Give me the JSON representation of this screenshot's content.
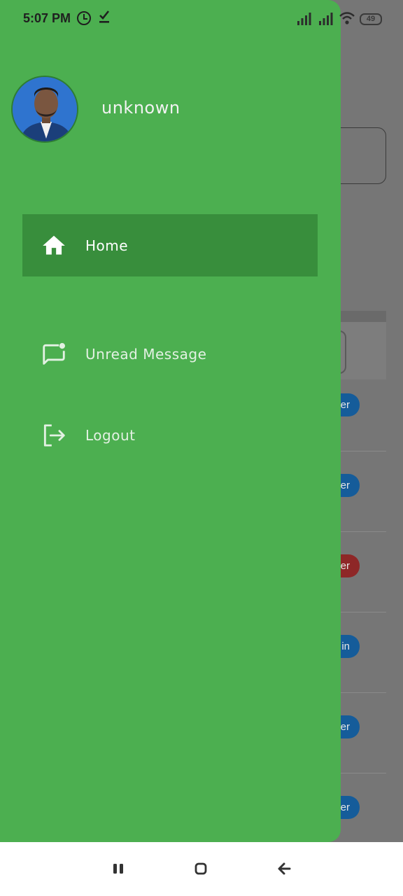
{
  "status_bar": {
    "time": "5:07 PM",
    "battery": "49",
    "icons": [
      "clock-icon",
      "download-done-icon",
      "signal-icon",
      "signal-icon",
      "wifi-icon",
      "battery-icon"
    ]
  },
  "drawer": {
    "username": "unknown",
    "items": [
      {
        "label": "Home",
        "icon": "home-icon",
        "active": true
      },
      {
        "label": "Unread Message",
        "icon": "message-badge-icon",
        "active": false
      },
      {
        "label": "Logout",
        "icon": "logout-icon",
        "active": false
      }
    ],
    "background_color": "#4caf50",
    "active_color": "#388e3c"
  },
  "background_content": {
    "pill_labels": [
      "er",
      "er",
      "er",
      "in",
      "er",
      "er"
    ]
  },
  "nav_bar": {
    "buttons": [
      "recents-icon",
      "home-nav-icon",
      "back-icon"
    ]
  }
}
